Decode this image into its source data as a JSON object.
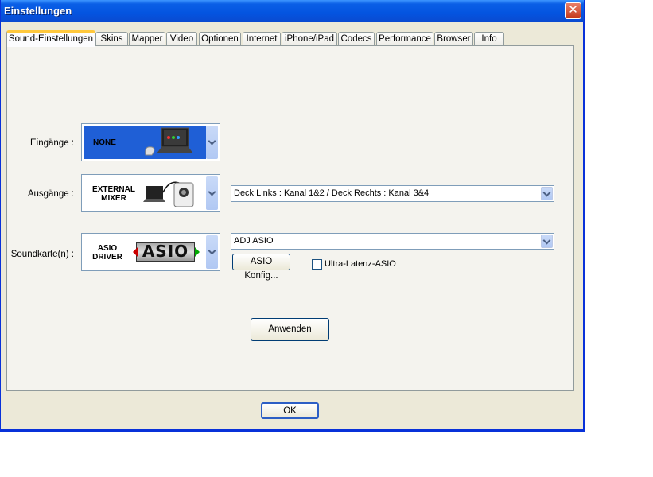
{
  "window": {
    "title": "Einstellungen",
    "close_symbol": "✕"
  },
  "tabs": [
    {
      "label": "Sound-Einstellungen",
      "active": true
    },
    {
      "label": "Skins"
    },
    {
      "label": "Mapper"
    },
    {
      "label": "Video"
    },
    {
      "label": "Optionen"
    },
    {
      "label": "Internet"
    },
    {
      "label": "iPhone/iPad"
    },
    {
      "label": "Codecs"
    },
    {
      "label": "Performance"
    },
    {
      "label": "Browser"
    },
    {
      "label": "Info"
    }
  ],
  "sound": {
    "inputs": {
      "label": "Eingänge :",
      "image_text": "NONE"
    },
    "outputs": {
      "label": "Ausgänge :",
      "image_text_line1": "EXTERNAL",
      "image_text_line2": "MIXER",
      "routing_value": "Deck Links : Kanal 1&2 / Deck Rechts : Kanal 3&4"
    },
    "soundcard": {
      "label": "Soundkarte(n) :",
      "image_text_line1": "ASIO",
      "image_text_line2": "DRIVER",
      "logo_text": "ASIO",
      "driver_value": "ADJ ASIO",
      "config_button": "ASIO Konfig...",
      "ultra_latency_label": "Ultra-Latenz-ASIO",
      "ultra_latency_checked": false
    },
    "apply_button": "Anwenden"
  },
  "footer": {
    "ok_button": "OK"
  },
  "colors": {
    "titlebar": "#0454e0",
    "dialog_bg": "#ece9d8",
    "image_blue": "#1f5fd6",
    "tab_active_accent": "#ffc83c"
  }
}
